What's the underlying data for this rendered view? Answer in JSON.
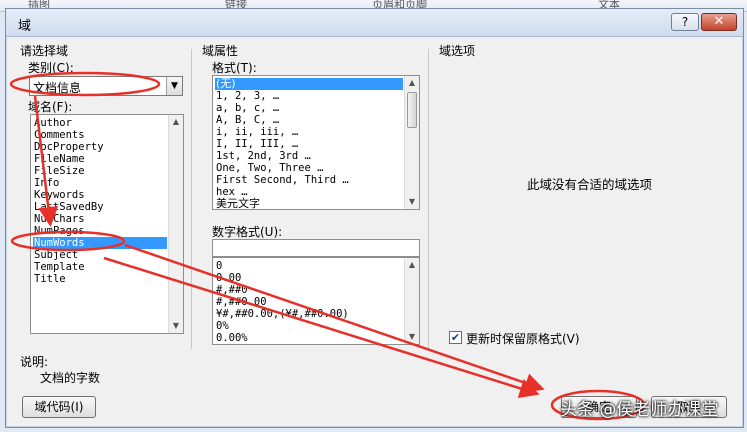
{
  "ribbon": {
    "items": [
      "插图",
      "链接",
      "页眉和页脚",
      "文本"
    ]
  },
  "dialog": {
    "title": "域",
    "help_label": "?",
    "close_label": "✕",
    "left": {
      "group_title": "请选择域",
      "category_label": "类别(C):",
      "category_value": "文档信息",
      "fieldname_label": "域名(F):",
      "field_names": [
        "Author",
        "Comments",
        "DocProperty",
        "FileName",
        "FileSize",
        "Info",
        "Keywords",
        "LastSavedBy",
        "NumChars",
        "NumPages",
        "NumWords",
        "Subject",
        "Template",
        "Title"
      ],
      "selected_field": "NumWords"
    },
    "middle": {
      "group_title": "域属性",
      "format_label": "格式(T):",
      "formats": [
        "(无)",
        "1, 2, 3, …",
        "a, b, c, …",
        "A, B, C, …",
        "i, ii, iii, …",
        "I, II, III, …",
        "1st, 2nd, 3rd …",
        "One, Two, Three …",
        "First Second, Third …",
        "hex …",
        "美元文字"
      ],
      "selected_format": "(无)",
      "numfmt_label": "数字格式(U):",
      "numfmt_value": "",
      "number_formats": [
        "0",
        "0.00",
        "#,##0",
        "#,##0.00",
        "¥#,##0.00;(¥#,##0.00)",
        "0%",
        "0.00%"
      ]
    },
    "right": {
      "group_title": "域选项",
      "no_options_text": "此域没有合适的域选项",
      "preserve_label": "更新时保留原格式(V)",
      "preserve_checked": true
    },
    "description": {
      "label": "说明:",
      "text": "文档的字数"
    },
    "buttons": {
      "field_codes": "域代码(I)",
      "ok": "确定",
      "cancel": "取消"
    }
  },
  "watermark": "头条 @侯老师办课堂",
  "annotation_color": "#e8302a"
}
